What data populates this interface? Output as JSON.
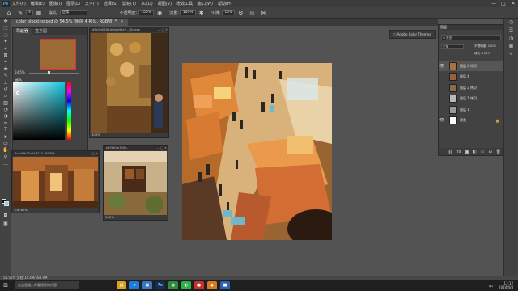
{
  "menubar": {
    "logo": "Ps",
    "items": [
      "文件(F)",
      "编辑(E)",
      "图像(I)",
      "图层(L)",
      "文字(Y)",
      "选择(S)",
      "滤镜(T)",
      "3D(D)",
      "视图(V)",
      "增效工具",
      "窗口(W)",
      "帮助(H)"
    ],
    "window_controls": [
      "—",
      "□",
      "✕"
    ]
  },
  "options_bar": {
    "icon": "brush-icon",
    "size": "3",
    "mode_label": "模式:",
    "mode_value": "正常",
    "opacity_label": "不透明度:",
    "opacity_value": "100%",
    "flow_label": "流量:",
    "flow_value": "100%",
    "smoothing_label": "平滑:",
    "smoothing_value": "10%"
  },
  "document_tab": {
    "label": "color blocking.psd @ 54.5% (图层 4 拷贝, RGB/8) *",
    "close": "×"
  },
  "navigator_panel": {
    "tabs": [
      "导航器",
      "直方图"
    ],
    "zoom": "54.5%",
    "color_label": "颜色"
  },
  "float_windows": [
    {
      "title": "d5c0e4f1ff2d4bba92e7...(Screen",
      "status": "100%"
    },
    {
      "title": "4c5a5fb12c14d213...RGB/8",
      "status": "106.62%"
    },
    {
      "title": "e2f39f4a7d3e...",
      "status": "100%"
    }
  ],
  "adobe_color_button": "Adobe Color Themes",
  "layers_panel": {
    "tab_label": "图层",
    "search_placeholder": "Q 类型",
    "blend_mode": "正常",
    "opacity_label": "不透明度: 100%",
    "fill_label": "填充: 100%",
    "layers": [
      {
        "name": "图层 4 拷贝",
        "visible": true,
        "selected": true,
        "color": "#b0703a"
      },
      {
        "name": "图层 4",
        "visible": false,
        "selected": false,
        "color": "#9a6238"
      },
      {
        "name": "图层 2 拷贝",
        "visible": false,
        "selected": false,
        "color": "#8c6a4a"
      },
      {
        "name": "图层 1 拷贝",
        "visible": false,
        "selected": false,
        "color": "#b9b9b9"
      },
      {
        "name": "图层 1",
        "visible": false,
        "selected": false,
        "color": "#9a9a9a"
      },
      {
        "name": "背景",
        "visible": true,
        "selected": false,
        "color": "#ffffff",
        "locked": true
      }
    ],
    "footer_icons": [
      "link-icon",
      "fx-icon",
      "mask-icon",
      "adjustment-icon",
      "group-icon",
      "new-layer-icon",
      "trash-icon"
    ]
  },
  "status_bar": "54.55%    文档:14.4M/183.9M",
  "taskbar": {
    "search_placeholder": "在这里输入你要搜索的内容",
    "apps": [
      {
        "name": "file-explorer",
        "glyph": "▤",
        "color": "#d9a520"
      },
      {
        "name": "edge",
        "glyph": "e",
        "color": "#1f7ad8"
      },
      {
        "name": "store",
        "glyph": "▣",
        "color": "#3a76c2"
      },
      {
        "name": "photoshop",
        "glyph": "Ps",
        "color": "#0e2f5a"
      },
      {
        "name": "chrome",
        "glyph": "◉",
        "color": "#2e8b3e"
      },
      {
        "name": "wechat",
        "glyph": "◐",
        "color": "#2bb24c"
      },
      {
        "name": "app-red",
        "glyph": "●",
        "color": "#c83030"
      },
      {
        "name": "app-orange",
        "glyph": "◆",
        "color": "#d87a20"
      },
      {
        "name": "app-blue",
        "glyph": "■",
        "color": "#2a62b8"
      }
    ],
    "time": "13:12",
    "date": "2024/4/8"
  }
}
